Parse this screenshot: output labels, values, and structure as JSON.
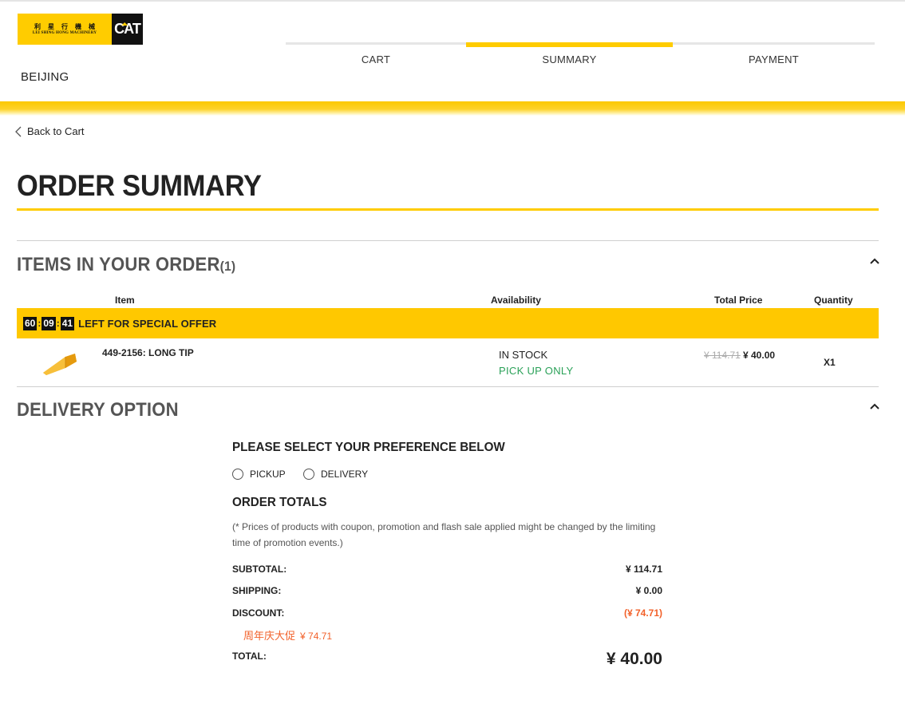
{
  "brand": {
    "cn_name": "利星行機械",
    "en_name": "LEI SHING HONG MACHINERY",
    "cat_logo": "CAT"
  },
  "header": {
    "city": "BEIJING"
  },
  "steps": [
    {
      "label": "CART",
      "active": false
    },
    {
      "label": "SUMMARY",
      "active": true
    },
    {
      "label": "PAYMENT",
      "active": false
    }
  ],
  "colors": {
    "accent": "#ffcc00",
    "success": "#2aa158",
    "discount": "#f2612a"
  },
  "back_link": "Back to Cart",
  "page_title": "ORDER SUMMARY",
  "items_section": {
    "title": "ITEMS IN YOUR ORDER",
    "count": "(1)",
    "columns": {
      "item": "Item",
      "availability": "Availability",
      "total_price": "Total Price",
      "quantity": "Quantity"
    },
    "offer": {
      "timer": [
        "60",
        "09",
        "41"
      ],
      "sep": ":",
      "text": "LEFT FOR SPECIAL OFFER"
    },
    "items": [
      {
        "name": "449-2156: LONG TIP",
        "stock": "IN STOCK",
        "pickup": "PICK UP ONLY",
        "price_old": "¥ 114.71",
        "price_new": "¥ 40.00",
        "qty": "X1"
      }
    ]
  },
  "delivery_section": {
    "title": "DELIVERY OPTION",
    "preference_title": "PLEASE SELECT YOUR PREFERENCE BELOW",
    "options": [
      {
        "label": "PICKUP",
        "selected": false
      },
      {
        "label": "DELIVERY",
        "selected": false
      }
    ]
  },
  "order_totals": {
    "title": "ORDER TOTALS",
    "note": "(* Prices of products with coupon, promotion and flash sale applied might be changed by the limiting time of promotion events.)",
    "subtotal_label": "SUBTOTAL:",
    "subtotal_value": "¥ 114.71",
    "shipping_label": "SHIPPING:",
    "shipping_value": "¥ 0.00",
    "discount_label": "DISCOUNT:",
    "discount_value": "(¥ 74.71)",
    "promo_name": "周年庆大促",
    "promo_value": "¥ 74.71",
    "total_label": "TOTAL:",
    "total_value": "¥ 40.00"
  },
  "icons": {
    "back": "chevron-left-icon",
    "collapse": "chevron-up-icon",
    "product": "bucket-tooth-image"
  }
}
